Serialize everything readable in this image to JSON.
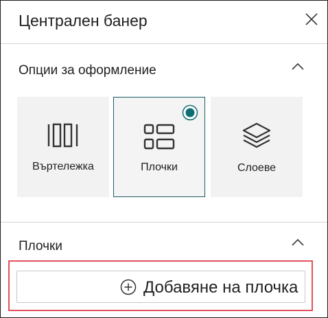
{
  "panel": {
    "title": "Централен банер",
    "close_icon": "close-icon"
  },
  "layout_section": {
    "title": "Опции за оформление",
    "chevron_icon": "chevron-up-icon",
    "options": [
      {
        "label": "Въртележка",
        "icon": "carousel-icon",
        "selected": false
      },
      {
        "label": "Плочки",
        "icon": "tiles-icon",
        "selected": true
      },
      {
        "label": "Слоеве",
        "icon": "layers-icon",
        "selected": false
      }
    ]
  },
  "tiles_section": {
    "title": "Плочки",
    "chevron_icon": "chevron-up-icon",
    "add_button": {
      "label": "Добавяне на плочка",
      "icon": "add-circle-icon"
    }
  },
  "colors": {
    "selected_border": "#1e5e66",
    "radio_fill": "#0f6e74",
    "highlight_border": "#e0515b"
  }
}
